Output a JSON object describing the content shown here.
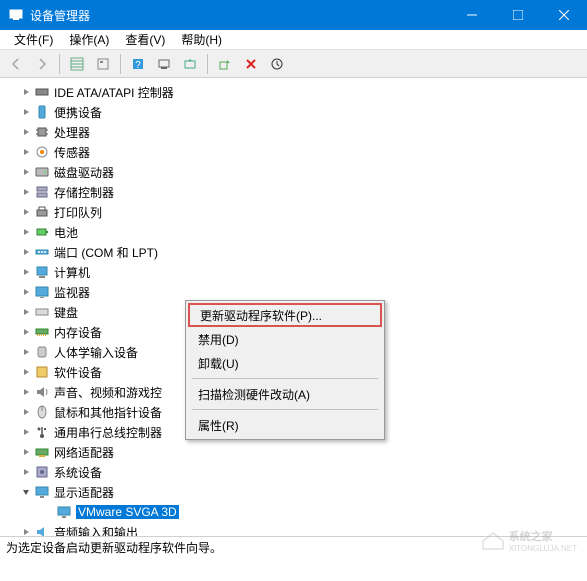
{
  "window": {
    "title": "设备管理器"
  },
  "menubar": {
    "file": "文件(F)",
    "action": "操作(A)",
    "view": "查看(V)",
    "help": "帮助(H)"
  },
  "tree": {
    "items": [
      {
        "label": "IDE ATA/ATAPI 控制器",
        "icon": "ide"
      },
      {
        "label": "便携设备",
        "icon": "portable"
      },
      {
        "label": "处理器",
        "icon": "cpu"
      },
      {
        "label": "传感器",
        "icon": "sensor"
      },
      {
        "label": "磁盘驱动器",
        "icon": "disk"
      },
      {
        "label": "存储控制器",
        "icon": "storage"
      },
      {
        "label": "打印队列",
        "icon": "printer"
      },
      {
        "label": "电池",
        "icon": "battery"
      },
      {
        "label": "端口 (COM 和 LPT)",
        "icon": "port"
      },
      {
        "label": "计算机",
        "icon": "computer"
      },
      {
        "label": "监视器",
        "icon": "monitor"
      },
      {
        "label": "键盘",
        "icon": "keyboard"
      },
      {
        "label": "内存设备",
        "icon": "memory"
      },
      {
        "label": "人体学输入设备",
        "icon": "hid"
      },
      {
        "label": "软件设备",
        "icon": "software"
      },
      {
        "label": "声音、视频和游戏控",
        "icon": "sound"
      },
      {
        "label": "鼠标和其他指针设备",
        "icon": "mouse"
      },
      {
        "label": "通用串行总线控制器",
        "icon": "usb"
      },
      {
        "label": "网络适配器",
        "icon": "network"
      },
      {
        "label": "系统设备",
        "icon": "system"
      },
      {
        "label": "显示适配器",
        "icon": "display",
        "expanded": true,
        "children": [
          {
            "label": "VMware SVGA 3D",
            "icon": "display",
            "selected": true
          }
        ]
      },
      {
        "label": "音频输入和输出",
        "icon": "audio"
      }
    ]
  },
  "context_menu": {
    "update": "更新驱动程序软件(P)...",
    "disable": "禁用(D)",
    "uninstall": "卸载(U)",
    "scan": "扫描检测硬件改动(A)",
    "properties": "属性(R)"
  },
  "statusbar": {
    "text": "为选定设备启动更新驱动程序软件向导。"
  },
  "watermark": {
    "text": "系统之家",
    "url": "XITONGLUJA.NET"
  }
}
